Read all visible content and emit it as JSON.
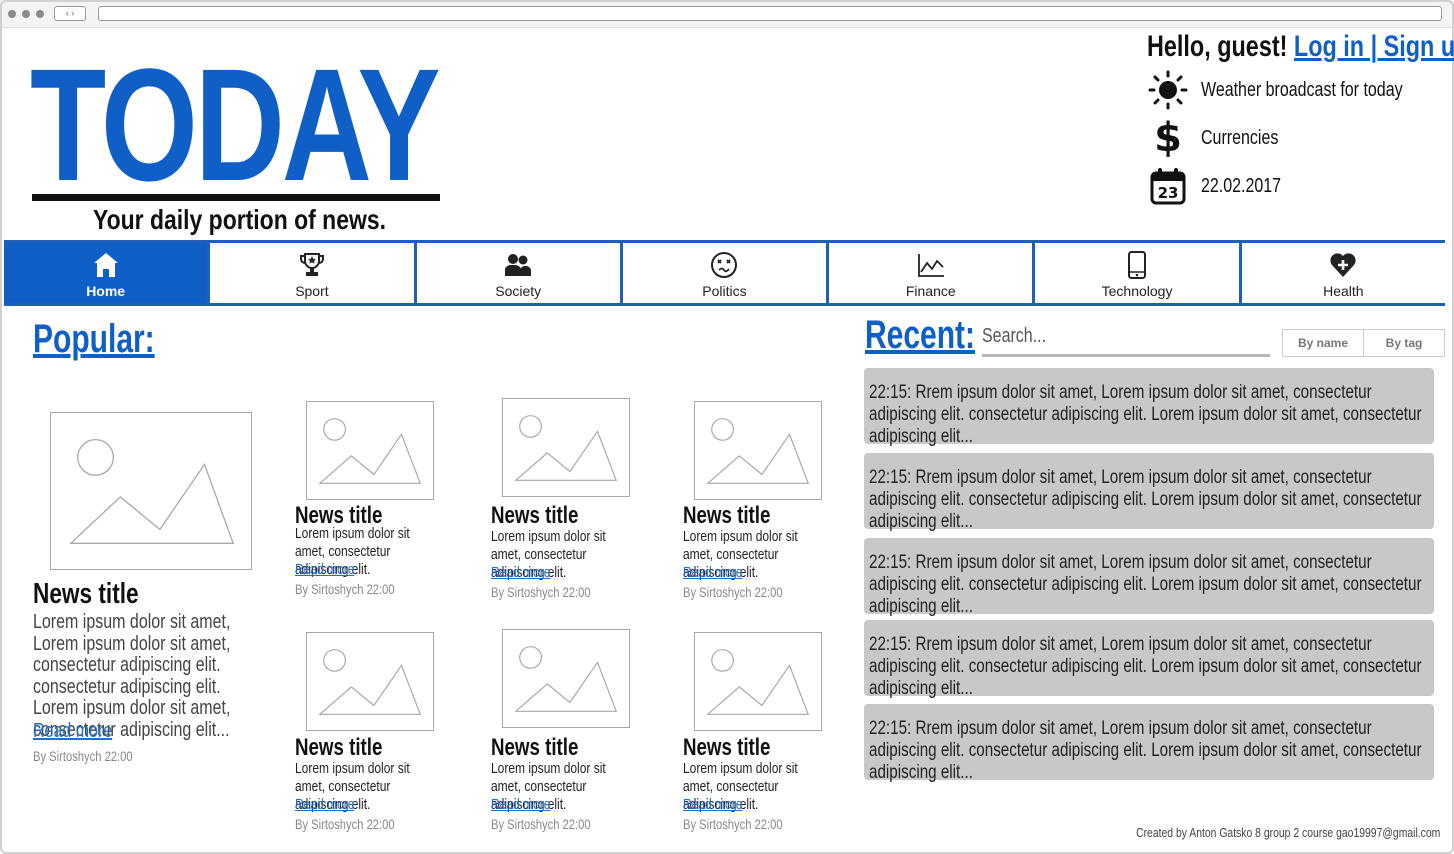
{
  "header": {
    "logo": "TODAY",
    "tagline": "Your daily portion of news.",
    "greeting": "Hello, guest!",
    "login_label": "Log in | Sign up",
    "weather": {
      "icon": "sun-icon",
      "label": "Weather broadcast for today"
    },
    "currencies": {
      "icon": "dollar-icon",
      "label": "Currencies"
    },
    "date": {
      "icon": "calendar-icon",
      "day": "23",
      "label": "22.02.2017"
    }
  },
  "nav": {
    "items": [
      {
        "label": "Home",
        "icon": "home-icon",
        "active": true
      },
      {
        "label": "Sport",
        "icon": "trophy-icon"
      },
      {
        "label": "Society",
        "icon": "people-icon"
      },
      {
        "label": "Politics",
        "icon": "confused-face-icon"
      },
      {
        "label": "Finance",
        "icon": "line-chart-icon"
      },
      {
        "label": "Technology",
        "icon": "phone-icon"
      },
      {
        "label": "Health",
        "icon": "heart-plus-icon"
      }
    ]
  },
  "popular": {
    "title": "Popular:",
    "featured": {
      "title": "News title",
      "body": "Lorem ipsum dolor sit amet, Lorem ipsum dolor sit amet, consectetur adipiscing elit. consectetur adipiscing elit. Lorem ipsum dolor sit amet, consectetur adipiscing elit...",
      "read_more": "Read more",
      "byline": "By Sirtoshych 22:00"
    },
    "cards": [
      {
        "title": "News title",
        "body": "Lorem ipsum dolor sit amet, consectetur adipiscing elit.",
        "read_more": "Read more",
        "byline": "By Sirtoshych 22:00"
      },
      {
        "title": "News title",
        "body": "Lorem ipsum dolor sit amet, consectetur adipiscing elit.",
        "read_more": "Read more",
        "byline": "By Sirtoshych 22:00"
      },
      {
        "title": "News title",
        "body": "Lorem ipsum dolor sit amet, consectetur adipiscing elit.",
        "read_more": "Read more",
        "byline": "By Sirtoshych 22:00"
      },
      {
        "title": "News title",
        "body": "Lorem ipsum dolor sit amet, consectetur adipiscing elit.",
        "read_more": "Read more",
        "byline": "By Sirtoshych 22:00"
      },
      {
        "title": "News title",
        "body": "Lorem ipsum dolor sit amet, consectetur adipiscing elit.",
        "read_more": "Read more",
        "byline": "By Sirtoshych 22:00"
      },
      {
        "title": "News title",
        "body": "Lorem ipsum dolor sit amet, consectetur adipiscing elit.",
        "read_more": "Read more",
        "byline": "By Sirtoshych 22:00"
      }
    ]
  },
  "recent": {
    "title": "Recent:",
    "search_placeholder": "Search...",
    "filter_by_name": "By name",
    "filter_by_tag": "By tag",
    "items": [
      {
        "text": "22:15: Rrem ipsum dolor sit amet, Lorem ipsum dolor sit amet, consectetur adipiscing elit. consectetur adipiscing elit. Lorem ipsum dolor sit amet, consectetur adipiscing elit..."
      },
      {
        "text": "22:15: Rrem ipsum dolor sit amet, Lorem ipsum dolor sit amet, consectetur adipiscing elit. consectetur adipiscing elit. Lorem ipsum dolor sit amet, consectetur adipiscing elit..."
      },
      {
        "text": "22:15: Rrem ipsum dolor sit amet, Lorem ipsum dolor sit amet, consectetur adipiscing elit. consectetur adipiscing elit. Lorem ipsum dolor sit amet, consectetur adipiscing elit..."
      },
      {
        "text": "22:15: Rrem ipsum dolor sit amet, Lorem ipsum dolor sit amet, consectetur adipiscing elit. consectetur adipiscing elit. Lorem ipsum dolor sit amet, consectetur adipiscing elit..."
      },
      {
        "text": "22:15: Rrem ipsum dolor sit amet, Lorem ipsum dolor sit amet, consectetur adipiscing elit. consectetur adipiscing elit. Lorem ipsum dolor sit amet, consectetur adipiscing elit..."
      }
    ]
  },
  "footer": {
    "credit": "Created by Anton Gatsko 8 group 2 course gao19997@gmail.com"
  },
  "colors": {
    "brand": "#0f5fc6",
    "nav_border": "#1e5fb8",
    "link": "#1e6ecf",
    "recent_bg": "#c8c8c8"
  }
}
